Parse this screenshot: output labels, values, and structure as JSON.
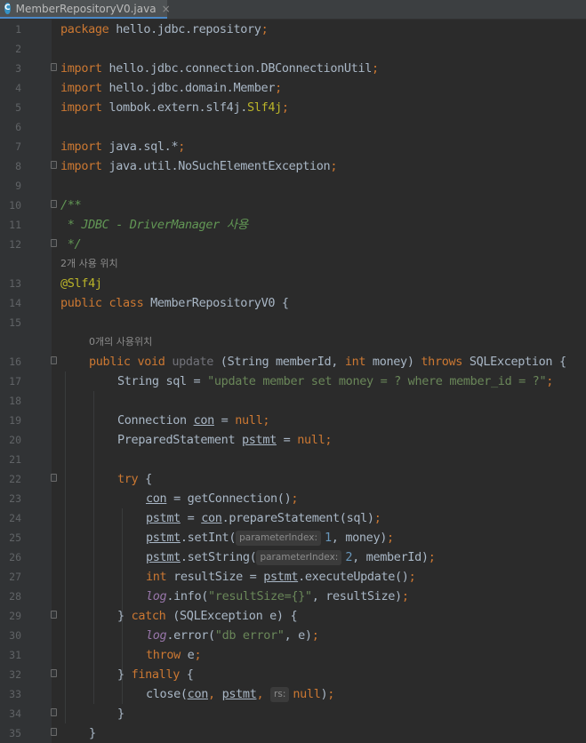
{
  "tab": {
    "title": "MemberRepositoryV0.java",
    "icon": "C",
    "close": "×"
  },
  "hints": {
    "class_usages": "2개 사용 위치",
    "method_usages": "0개의 사용위치",
    "param_index": "parameterIndex:",
    "param_rs": "rs:"
  },
  "lines": [
    "1",
    "2",
    "3",
    "4",
    "5",
    "6",
    "7",
    "8",
    "9",
    "10",
    "11",
    "12",
    "13",
    "14",
    "15",
    "16",
    "17",
    "18",
    "19",
    "20",
    "21",
    "22",
    "23",
    "24",
    "25",
    "26",
    "27",
    "28",
    "29",
    "30",
    "31",
    "32",
    "33",
    "34",
    "35"
  ],
  "code": {
    "l1": [
      "package",
      " hello.jdbc.repository",
      ";"
    ],
    "l3": [
      "import",
      " hello.jdbc.connection.DBConnectionUtil",
      ";"
    ],
    "l4": [
      "import",
      " hello.jdbc.domain.Member",
      ";"
    ],
    "l5": [
      "import",
      " lombok.extern.slf4j.",
      "Slf4j",
      ";"
    ],
    "l7": [
      "import",
      " java.sql.*",
      ";"
    ],
    "l8": [
      "import",
      " java.util.NoSuchElementException",
      ";"
    ],
    "l10": "/**",
    "l11": " * JDBC - DriverManager 사용",
    "l12": " */",
    "l13": "@Slf4j",
    "l14": [
      "public",
      " ",
      "class",
      " MemberRepositoryV0 {"
    ],
    "l16": [
      "public",
      " ",
      "void",
      " ",
      "update",
      " (String memberId, ",
      "int",
      " money) ",
      "throws",
      " SQLException {"
    ],
    "l17": [
      "String sql = ",
      "\"update member set money = ? where member_id = ?\"",
      ";"
    ],
    "l19": [
      "Connection ",
      "con",
      " = ",
      "null",
      ";"
    ],
    "l20": [
      "PreparedStatement ",
      "pstmt",
      " = ",
      "null",
      ";"
    ],
    "l22": [
      "try",
      " {"
    ],
    "l23": [
      "con",
      " = getConnection()",
      ";"
    ],
    "l24": [
      "pstmt",
      " = ",
      "con",
      ".prepareStatement(sql)",
      ";"
    ],
    "l25": [
      "pstmt",
      ".setInt(",
      "1",
      ", money)",
      ";"
    ],
    "l26": [
      "pstmt",
      ".setString(",
      "2",
      ", memberId)",
      ";"
    ],
    "l27": [
      "int",
      " resultSize = ",
      "pstmt",
      ".executeUpdate()",
      ";"
    ],
    "l28": [
      "log",
      ".info(",
      "\"resultSize={}\"",
      ", resultSize)",
      ";"
    ],
    "l29": [
      "} ",
      "catch",
      " (SQLException e) {"
    ],
    "l30": [
      "log",
      ".error(",
      "\"db error\"",
      ", e)",
      ";"
    ],
    "l31": [
      "throw",
      " e",
      ";"
    ],
    "l32": [
      "} ",
      "finally",
      " {"
    ],
    "l33": [
      "close(",
      "con",
      ", ",
      "pstmt",
      ", ",
      "null",
      ")",
      ";"
    ],
    "l34": "}",
    "l35": "}"
  },
  "colors": {
    "background": "#2b2b2b",
    "gutter": "#313335",
    "keyword": "#cc7832",
    "string": "#6a8759",
    "comment": "#629755",
    "annotation": "#bbb529",
    "field": "#9876aa",
    "default_text": "#a9b7c6"
  }
}
